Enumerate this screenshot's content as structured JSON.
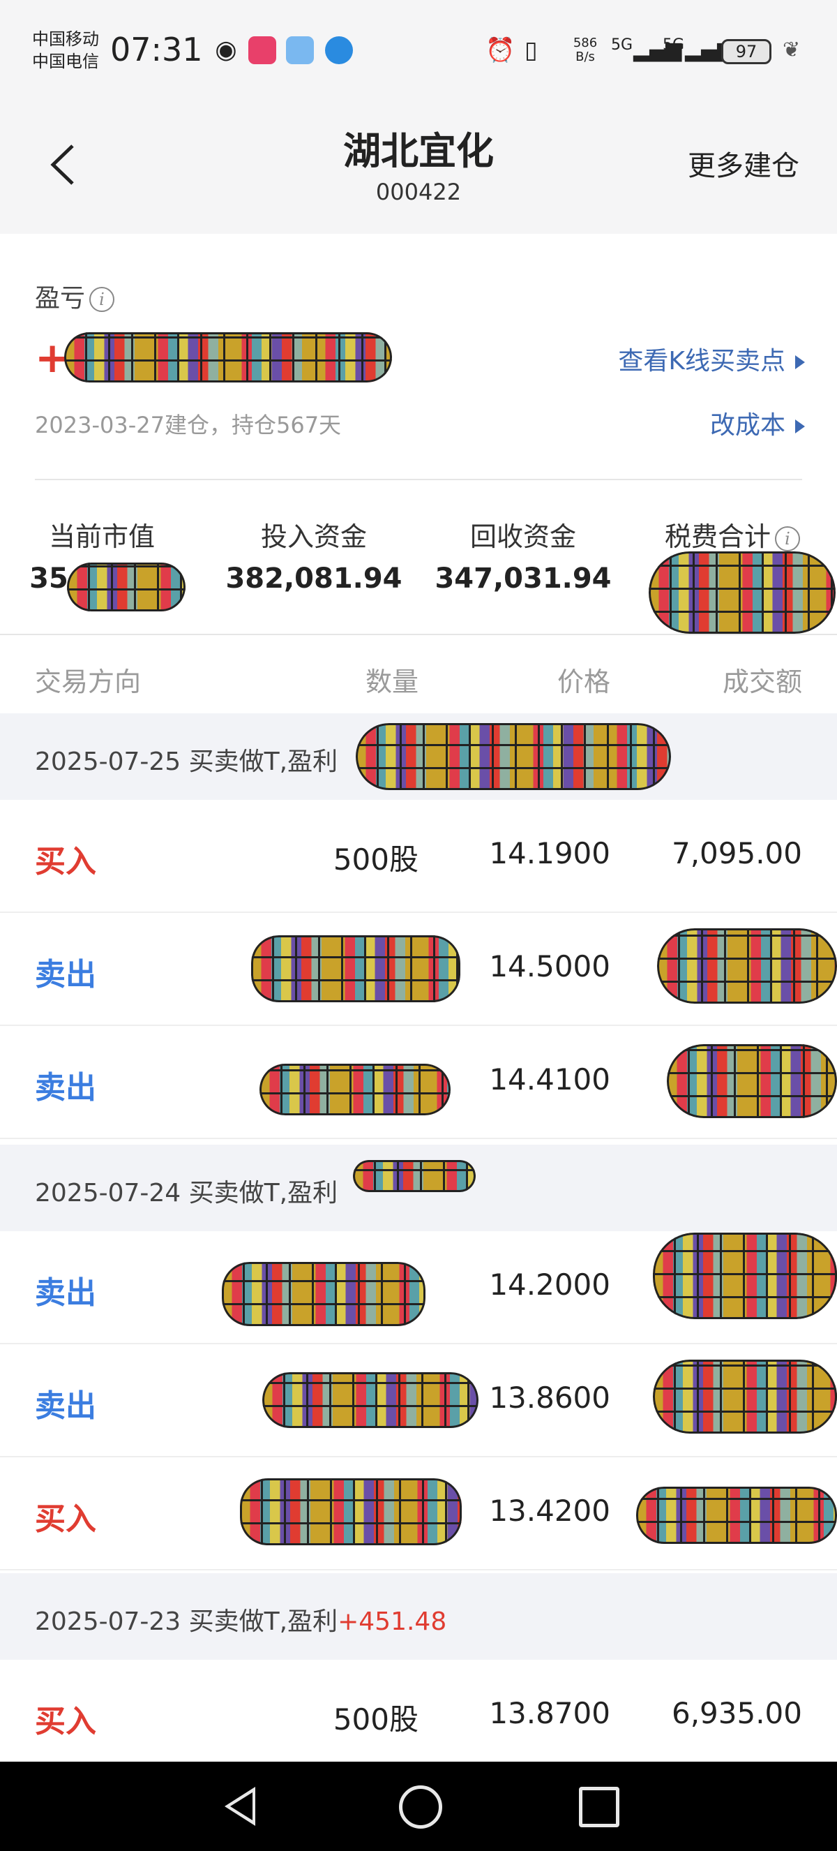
{
  "status_bar": {
    "carrier1": "中国移动",
    "carrier2": "中国电信",
    "time": "07:31",
    "net_speed": "586 B/s",
    "signal1": "5G",
    "signal2": "5G",
    "battery": "97"
  },
  "header": {
    "title": "湖北宜化",
    "code": "000422",
    "more_label": "更多建仓",
    "back_icon": "chevron-left-icon"
  },
  "summary": {
    "pnl_label": "盈亏",
    "pnl_prefix": "+2",
    "kline_link": "查看K线买卖点",
    "since_text": "2023-03-27建仓，持仓567天",
    "cost_link": "改成本",
    "stats": [
      {
        "label": "当前市值",
        "value": "35"
      },
      {
        "label": "投入资金",
        "value": "382,081.94"
      },
      {
        "label": "回收资金",
        "value": "347,031.94"
      },
      {
        "label": "税费合计",
        "value": ""
      }
    ]
  },
  "table": {
    "headers": [
      "交易方向",
      "数量",
      "价格",
      "成交额"
    ],
    "groups": [
      {
        "date_text": "2025-07-25 买卖做T,盈利",
        "profit": "",
        "rows": [
          {
            "dir": "买入",
            "qty": "500股",
            "price": "14.1900",
            "amount": "7,095.00"
          },
          {
            "dir": "卖出",
            "qty": "",
            "price": "14.5000",
            "amount": ""
          },
          {
            "dir": "卖出",
            "qty": "",
            "price": "14.4100",
            "amount": ""
          }
        ]
      },
      {
        "date_text": "2025-07-24 买卖做T,盈利",
        "profit": "",
        "rows": [
          {
            "dir": "卖出",
            "qty": "",
            "price": "14.2000",
            "amount": ""
          },
          {
            "dir": "卖出",
            "qty": "",
            "price": "13.8600",
            "amount": ""
          },
          {
            "dir": "买入",
            "qty": "",
            "price": "13.4200",
            "amount": ""
          }
        ]
      },
      {
        "date_text": "2025-07-23 买卖做T,盈利",
        "profit": "+451.48",
        "rows": [
          {
            "dir": "买入",
            "qty": "500股",
            "price": "13.8700",
            "amount": "6,935.00"
          }
        ]
      }
    ]
  },
  "colors": {
    "buy": "#e03c31",
    "sell": "#3b7de0",
    "link": "#3d69b3"
  }
}
